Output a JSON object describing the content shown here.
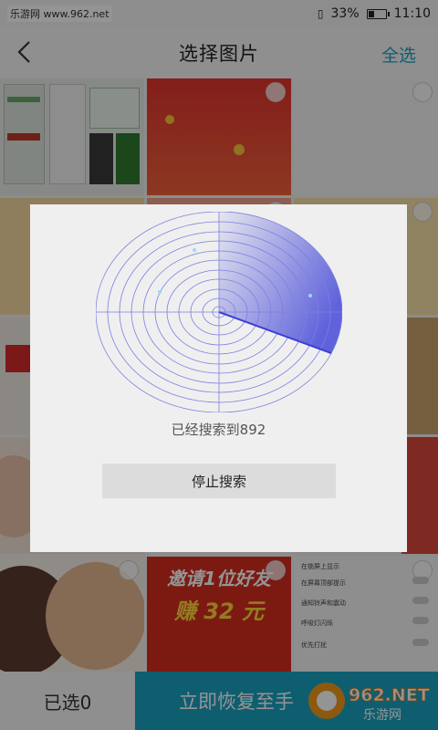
{
  "status": {
    "site": "乐游网 www.962.net",
    "battery": "33%",
    "battery_level": 0.33,
    "time": "11:10"
  },
  "header": {
    "title": "选择图片",
    "select_all": "全选"
  },
  "grid": {
    "promo_invite": "邀请1位好友",
    "promo_reward": "赚 32 元",
    "settings_rows": [
      "在锁屏上显示",
      "在屏幕顶部提示",
      "通知铃声和震动",
      "呼吸灯闪烁",
      "优先打扰"
    ]
  },
  "dialog": {
    "found_text": "已经搜索到892",
    "stop_button": "停止搜索"
  },
  "bottom": {
    "selected": "已选0",
    "restore": "立即恢复至手"
  },
  "watermark": {
    "brand": "962.NET",
    "sub": "乐游网"
  },
  "colors": {
    "accent": "#1aa3c4",
    "radar_line": "#7c7fe0",
    "radar_sweep": "#3b3fd6"
  }
}
